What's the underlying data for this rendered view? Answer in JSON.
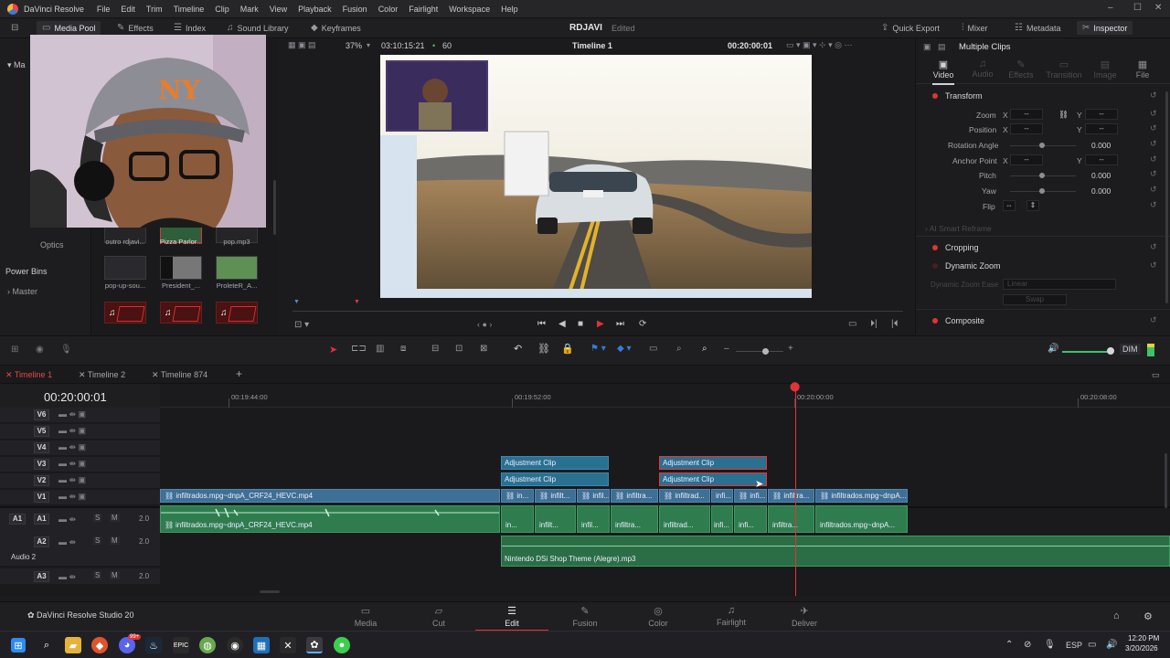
{
  "app": {
    "title": "DaVinci Resolve",
    "menu": [
      "File",
      "Edit",
      "Trim",
      "Timeline",
      "Clip",
      "Mark",
      "View",
      "Playback",
      "Fusion",
      "Color",
      "Fairlight",
      "Workspace",
      "Help"
    ]
  },
  "toolbar": {
    "media_pool": "Media Pool",
    "effects": "Effects",
    "index": "Index",
    "sound_library": "Sound Library",
    "keyframes": "Keyframes",
    "project_name": "RDJAVI",
    "project_status": "Edited",
    "quick_export": "Quick Export",
    "mixer": "Mixer",
    "metadata": "Metadata",
    "inspector": "Inspector"
  },
  "left_panel": {
    "optics": "Optics",
    "power_bins": "Power Bins",
    "master": "Master"
  },
  "media_pool": {
    "items": [
      {
        "label": "outro rdjavi...",
        "kind": "video"
      },
      {
        "label": "Pizza Parlor...",
        "kind": "video"
      },
      {
        "label": "pop.mp3",
        "kind": "audio"
      },
      {
        "label": "pop-up-sou...",
        "kind": "audio"
      },
      {
        "label": "President_...",
        "kind": "video"
      },
      {
        "label": "ProleteR_A...",
        "kind": "video"
      }
    ]
  },
  "viewer": {
    "zoom": "37%",
    "source_timecode": "03:10:15:21",
    "fps": "60",
    "timeline_name": "Timeline 1",
    "timecode": "00:20:00:01"
  },
  "inspector": {
    "title": "Multiple Clips",
    "tabs": [
      "Video",
      "Audio",
      "Effects",
      "Transition",
      "Image",
      "File"
    ],
    "transform": "Transform",
    "rows": [
      {
        "label": "Zoom",
        "x": "--",
        "y": "--"
      },
      {
        "label": "Position",
        "x": "--",
        "y": "--"
      },
      {
        "label": "Rotation Angle",
        "value": "0.000"
      },
      {
        "label": "Anchor Point",
        "x": "--",
        "y": "--"
      },
      {
        "label": "Pitch",
        "value": "0.000"
      },
      {
        "label": "Yaw",
        "value": "0.000"
      },
      {
        "label": "Flip"
      }
    ],
    "smart_reframe": "AI Smart Reframe",
    "cropping": "Cropping",
    "dynamic_zoom": "Dynamic Zoom",
    "dynamic_zoom_ease": "Dynamic Zoom Ease",
    "dynamic_zoom_ease_value": "Linear",
    "swap": "Swap",
    "composite": "Composite",
    "axis_x": "X",
    "axis_y": "Y"
  },
  "timeline": {
    "tabs": [
      "Timeline 1",
      "Timeline 2",
      "Timeline 874"
    ],
    "playhead_tc": "00:20:00:01",
    "ruler": [
      "00:19:44:00",
      "00:19:52:00",
      "00:20:00:00",
      "00:20:08:00"
    ],
    "dim": "DIM",
    "video_tracks": [
      "V6",
      "V5",
      "V4",
      "V3",
      "V2",
      "V1"
    ],
    "audio_tracks": [
      {
        "badge": "A1",
        "gain": "2.0"
      },
      {
        "badge": "A2",
        "gain": "2.0",
        "name": "Audio 2"
      },
      {
        "badge": "A3",
        "gain": "2.0"
      }
    ],
    "clips": {
      "adjustment": "Adjustment Clip",
      "v1_main": "infiltrados.mpg~dnpA_CRF24_HEVC.mp4",
      "a1_main": "infiltrados.mpg~dnpA_CRF24_HEVC.mp4",
      "v1_small": [
        "in...",
        "infilt...",
        "infil...",
        "infiltra...",
        "infiltrad...",
        "infi...",
        "infi...",
        "infiltra...",
        "infiltrados.mpg~dnpA..."
      ],
      "a2_music": "Nintendo DSi Shop Theme (Alegre).mp3"
    }
  },
  "pages": [
    "Media",
    "Cut",
    "Edit",
    "Fusion",
    "Color",
    "Fairlight",
    "Deliver"
  ],
  "studio_label": "DaVinci Resolve Studio 20",
  "taskbar": {
    "lang": "ESP",
    "time": "12:20 PM",
    "date": "3/20/2026",
    "badge": "99+"
  }
}
